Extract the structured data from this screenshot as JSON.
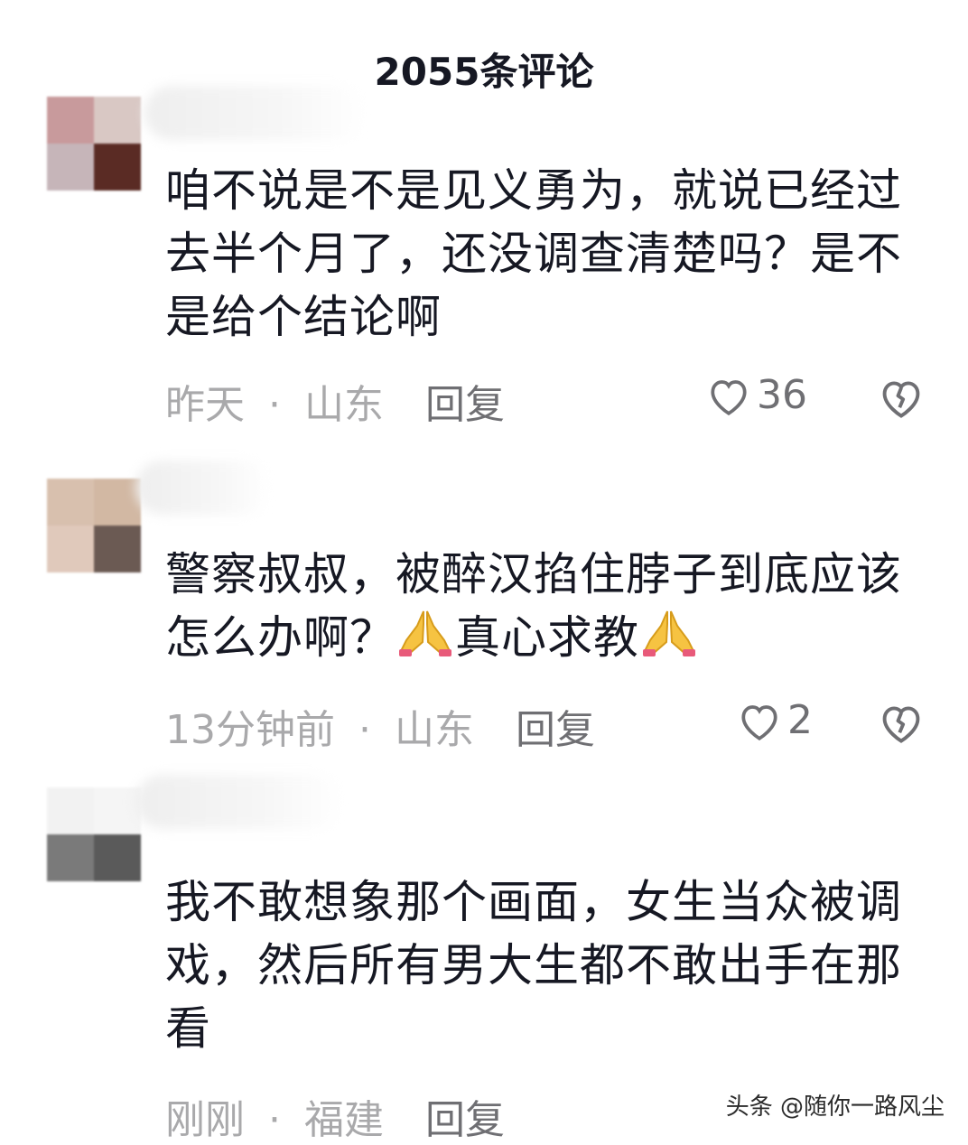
{
  "header": {
    "title": "2055条评论"
  },
  "comments": [
    {
      "text": "咱不说是不是见义勇为，就说已经过去半个月了，还没调查清楚吗？是不是给个结论啊",
      "time": "昨天",
      "separator": "·",
      "location": "山东",
      "reply_label": "回复",
      "likes": "36"
    },
    {
      "text_before": "警察叔叔，被醉汉掐住脖子到底应该怎么办啊？",
      "text_middle": "真心求教",
      "time": "13分钟前",
      "separator": "·",
      "location": "山东",
      "reply_label": "回复",
      "likes": "2"
    },
    {
      "text": "我不敢想象那个画面，女生当众被调戏，然后所有男大生都不敢出手在那看",
      "time": "刚刚",
      "separator": "·",
      "location": "福建",
      "reply_label": "回复"
    }
  ],
  "watermark": "头条 @随你一路风尘",
  "colors": {
    "primary_text": "#161823",
    "meta_text": "#a9a9ab",
    "action_text": "#6f6f73"
  }
}
